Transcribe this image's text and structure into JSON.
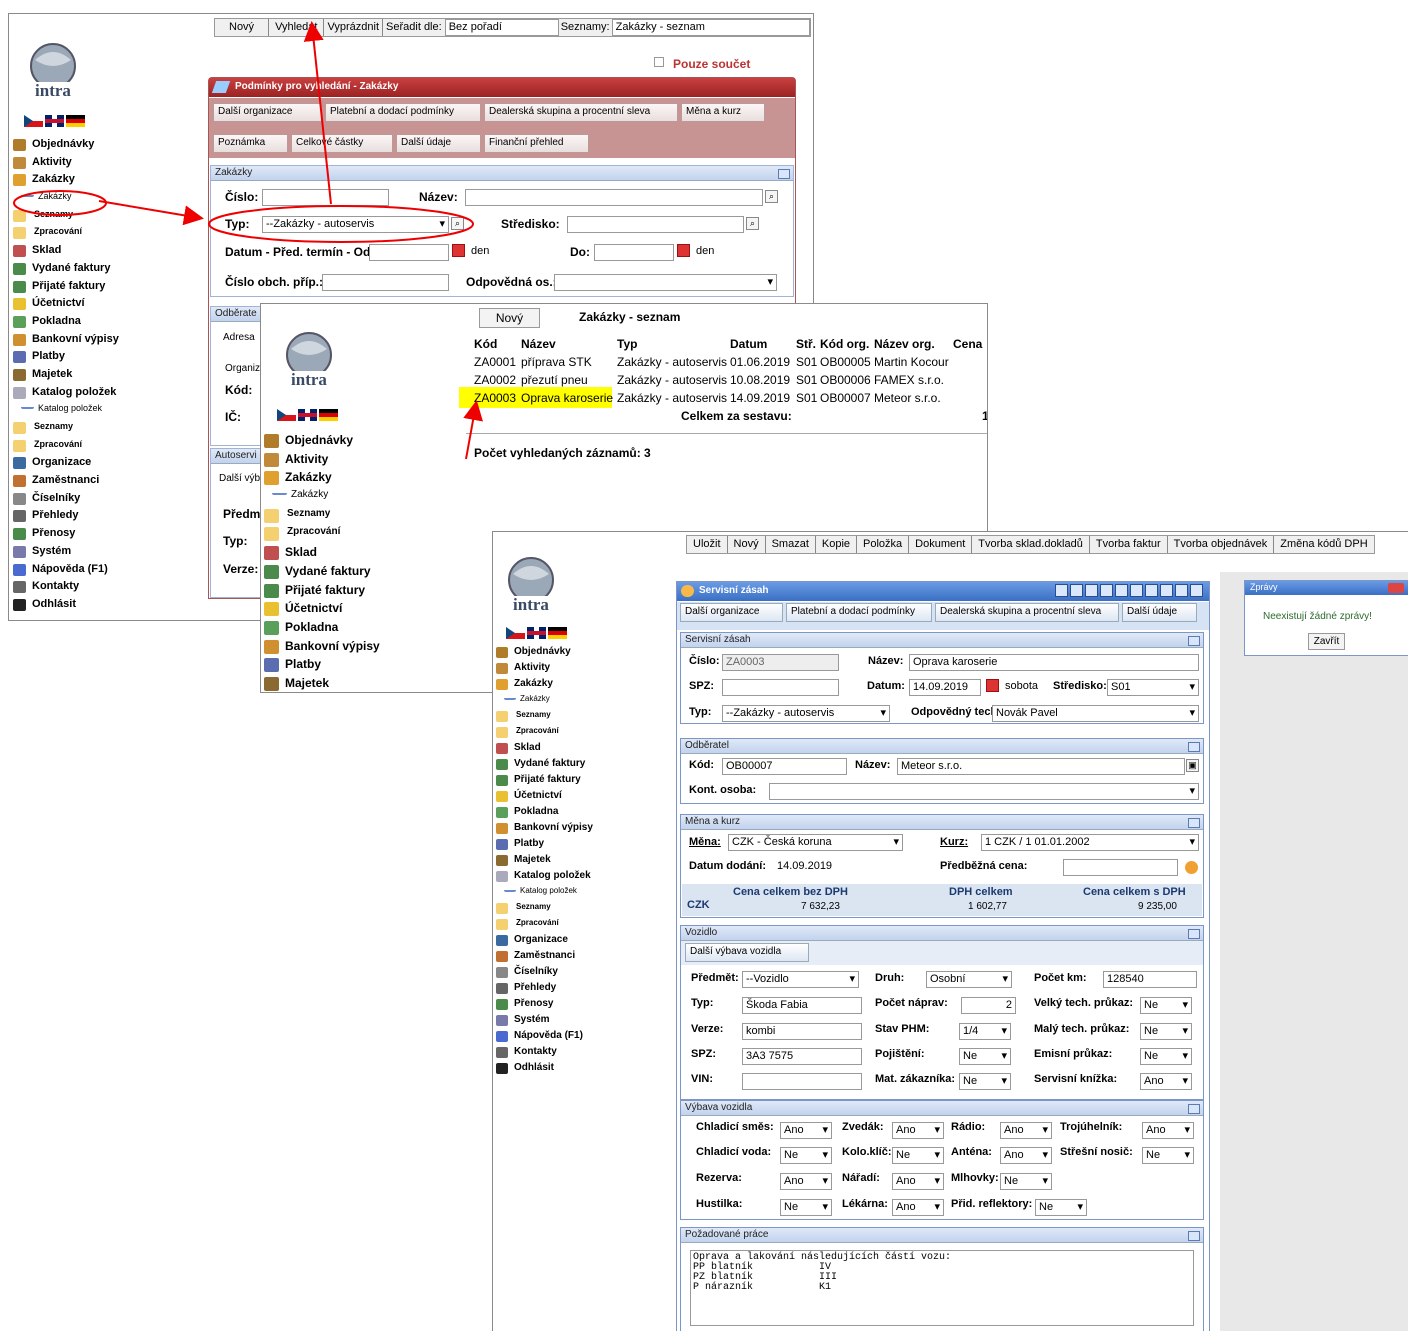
{
  "app_name": "intra",
  "sidebar": {
    "items": [
      "Objednávky",
      "Aktivity",
      "Zakázky",
      "Zakázky",
      "Seznamy",
      "Zpracování",
      "Sklad",
      "Vydané faktury",
      "Přijaté faktury",
      "Účetnictví",
      "Pokladna",
      "Bankovní výpisy",
      "Platby",
      "Majetek",
      "Katalog položek",
      "Katalog položek",
      "Seznamy",
      "Zpracování",
      "Organizace",
      "Zaměstnanci",
      "Číselníky",
      "Přehledy",
      "Přenosy",
      "Systém",
      "Nápověda (F1)",
      "Kontakty",
      "Odhlásit"
    ]
  },
  "win1": {
    "toolbar": {
      "new": "Nový",
      "search": "Vyhledat",
      "clear": "Vyprázdnit",
      "sort_label": "Seřadit dle:",
      "sort_value": "Bez pořadí",
      "lists_label": "Seznamy:",
      "lists_value": "Zakázky - seznam"
    },
    "sum_only": "Pouze součet",
    "panel_title": "Podmínky pro vyhledání - Zakázky",
    "tabs": [
      "Další organizace",
      "Platební a dodací podmínky",
      "Dealerská skupina a procentní sleva",
      "Měna a kurz",
      "Poznámka",
      "Celkové částky",
      "Další údaje",
      "Finanční přehled"
    ],
    "section": "Zakázky",
    "cislo_label": "Číslo:",
    "nazev_label": "Název:",
    "typ_label": "Typ:",
    "typ_value": "--Zakázky - autoservis",
    "stredisko_label": "Středisko:",
    "datum_label": "Datum - Před. termín - Od:",
    "den": "den",
    "do_label": "Do:",
    "cislo_obch_label": "Číslo obch. příp.:",
    "odpovedna_label": "Odpovědná os.:",
    "odberatel_section": "Odběrate",
    "adresa": "Adresa",
    "organiz": "Organiz",
    "kod": "Kód:",
    "ic": "IČ:",
    "autoservis_section": "Autoservi",
    "dalsi_vyb": "Další výb",
    "predmet": "Předm",
    "typ2": "Typ:",
    "verze": "Verze:"
  },
  "win2": {
    "new": "Nový",
    "title": "Zakázky - seznam",
    "headers": [
      "Kód",
      "Název",
      "Typ",
      "Datum",
      "Stř.",
      "Kód org.",
      "Název org.",
      "Cena"
    ],
    "rows": [
      [
        "ZA0001",
        "příprava STK",
        "Zakázky - autoservis",
        "01.06.2019",
        "S01",
        "OB00005",
        "Martin Kocour"
      ],
      [
        "ZA0002",
        "přezutí pneu",
        "Zakázky - autoservis",
        "10.08.2019",
        "S01",
        "OB00006",
        "FAMEX s.r.o."
      ],
      [
        "ZA0003",
        "Oprava karoserie",
        "Zakázky - autoservis",
        "14.09.2019",
        "S01",
        "OB00007",
        "Meteor s.r.o."
      ]
    ],
    "total": "Celkem za sestavu:",
    "total_value": "1",
    "count": "Počet vyhledaných záznamů: 3"
  },
  "win3": {
    "toolbar": [
      "Uložit",
      "Nový",
      "Smazat",
      "Kopie",
      "Položka",
      "Dokument",
      "Tvorba sklad.dokladů",
      "Tvorba faktur",
      "Tvorba objednávek",
      "Změna kódů DPH"
    ],
    "title": "Servisní zásah",
    "tabs": [
      "Další organizace",
      "Platební a dodací podmínky",
      "Dealerská skupina a procentní sleva",
      "Další údaje"
    ],
    "sec1": "Servisní zásah",
    "cislo_label": "Číslo:",
    "cislo": "ZA0003",
    "nazev_label": "Název:",
    "nazev": "Oprava karoserie",
    "spz_label": "SPZ:",
    "datum_label": "Datum:",
    "datum": "14.09.2019",
    "den": "sobota",
    "stredisko_label": "Středisko:",
    "stredisko": "S01",
    "typ_label": "Typ:",
    "typ": "--Zakázky - autoservis",
    "tech_label": "Odpovědný tech",
    "tech": "Novák Pavel",
    "sec2": "Odběratel",
    "kod_label": "Kód:",
    "kod": "OB00007",
    "org_label": "Název:",
    "org": "Meteor s.r.o.",
    "kont_label": "Kont. osoba:",
    "sec3": "Měna a kurz",
    "mena_label": "Měna:",
    "mena": "CZK - Česká koruna",
    "kurz_label": "Kurz:",
    "kurz": "1 CZK / 1 01.01.2002",
    "dodani_label": "Datum dodání:",
    "dodani": "14.09.2019",
    "predb_label": "Předběžná cena:",
    "tot_h": [
      "Cena celkem bez DPH",
      "DPH celkem",
      "Cena celkem s DPH"
    ],
    "tot_cur": "CZK",
    "tot_v": [
      "7 632,23",
      "1 602,77",
      "9 235,00"
    ],
    "sec4": "Vozidlo",
    "vyb_tab": "Další výbava vozidla",
    "predmet_label": "Předmět:",
    "predmet": "--Vozidlo",
    "druh_label": "Druh:",
    "druh": "Osobní",
    "km_label": "Počet km:",
    "km": "128540",
    "typ2_label": "Typ:",
    "typ2": "Škoda Fabia",
    "naprav_label": "Počet náprav:",
    "naprav": "2",
    "velky_label": "Velký tech. průkaz:",
    "velky": "Ne",
    "verze_label": "Verze:",
    "verze": "kombi",
    "phm_label": "Stav PHM:",
    "phm": "1/4",
    "maly_label": "Malý tech. průkaz:",
    "maly": "Ne",
    "spz2_label": "SPZ:",
    "spz2": "3A3 7575",
    "poj_label": "Pojištění:",
    "poj": "Ne",
    "emis_label": "Emisní průkaz:",
    "emis": "Ne",
    "vin_label": "VIN:",
    "mat_label": "Mat. zákazníka:",
    "mat": "Ne",
    "serv_label": "Servisní knížka:",
    "serv": "Ano",
    "sec5": "Výbava vozidla",
    "eq": [
      [
        "Chladicí směs:",
        "Ano",
        "Zvedák:",
        "Ano",
        "Rádio:",
        "Ano",
        "Trojúhelník:",
        "Ano"
      ],
      [
        "Chladicí voda:",
        "Ne",
        "Kolo.klíč:",
        "Ne",
        "Anténa:",
        "Ano",
        "Střešní nosič:",
        "Ne"
      ],
      [
        "Rezerva:",
        "Ano",
        "Nářadí:",
        "Ano",
        "Mlhovky:",
        "Ne"
      ],
      [
        "Hustilka:",
        "Ne",
        "Lékárna:",
        "Ano",
        "Přid. reflektory:",
        "Ne"
      ]
    ],
    "sec6": "Požadované práce",
    "works": "Oprava a lakování následujících částí vozu:\nPP blatník           IV\nPZ blatník           III\nP nárazník           K1"
  },
  "messages": {
    "title": "Zprávy",
    "text": "Neexistují žádné zprávy!",
    "close": "Zavřít"
  }
}
